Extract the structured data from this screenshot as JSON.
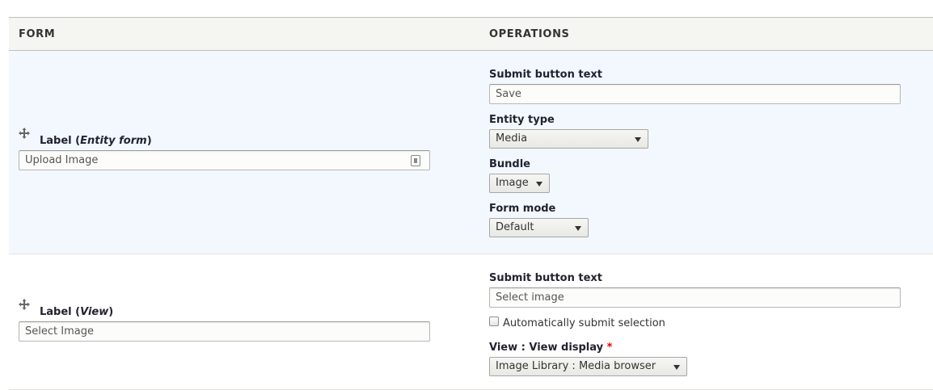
{
  "table": {
    "headers": {
      "form": "FORM",
      "operations": "OPERATIONS"
    }
  },
  "rows": [
    {
      "label_prefix": "Label (",
      "label_em": "Entity form",
      "label_suffix": ")",
      "label_value": "Upload Image",
      "submit_label": "Submit button text",
      "submit_value": "Save",
      "entity_type_label": "Entity type",
      "entity_type_value": "Media",
      "bundle_label": "Bundle",
      "bundle_value": "Image",
      "form_mode_label": "Form mode",
      "form_mode_value": "Default"
    },
    {
      "label_prefix": "Label (",
      "label_em": "View",
      "label_suffix": ")",
      "label_value": "Select Image",
      "submit_label": "Submit button text",
      "submit_value": "Select image",
      "auto_submit_label": "Automatically submit selection",
      "auto_submit_checked": false,
      "view_display_label": "View : View display",
      "view_display_required": "*",
      "view_display_value": "Image Library : Media browser"
    }
  ]
}
